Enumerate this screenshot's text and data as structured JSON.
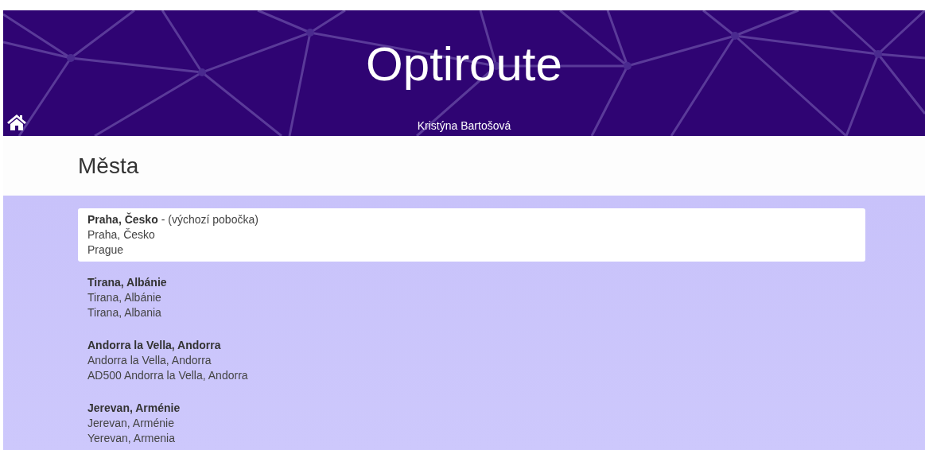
{
  "header": {
    "title": "Optiroute",
    "user": "Kristýna Bartošová"
  },
  "page_title": "Města",
  "cities": [
    {
      "name": "Praha, Česko",
      "note": "- (výchozí pobočka)",
      "lines": [
        "Praha, Česko",
        "Prague"
      ],
      "selected": true
    },
    {
      "name": "Tirana, Albánie",
      "lines": [
        "Tirana, Albánie",
        "Tirana, Albania"
      ],
      "selected": false
    },
    {
      "name": "Andorra la Vella, Andorra",
      "lines": [
        "Andorra la Vella, Andorra",
        "AD500 Andorra la Vella, Andorra"
      ],
      "selected": false
    },
    {
      "name": "Jerevan, Arménie",
      "lines": [
        "Jerevan, Arménie",
        "Yerevan, Armenia"
      ],
      "selected": false
    }
  ]
}
